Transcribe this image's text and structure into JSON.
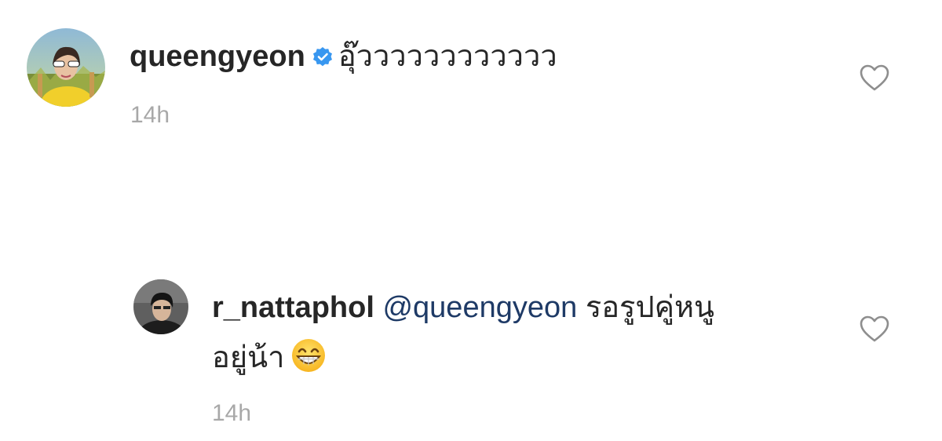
{
  "comments": [
    {
      "username": "queengyeon",
      "verified": true,
      "text": "อุ๊วววววววววววว",
      "time": "14h",
      "like_icon": "heart-outline-icon"
    },
    {
      "username": "r_nattaphol",
      "mention": "@queengyeon",
      "text_line1": "รอรูปคู่หนู",
      "text_line2": "อยู่น้า",
      "emoji_icon": "grinning-face-emoji-icon",
      "time": "14h",
      "like_icon": "heart-outline-icon"
    }
  ],
  "colors": {
    "text": "#262626",
    "mention": "#1e3a66",
    "timestamp": "#a8a8a8",
    "verified_badge": "#3897f0"
  }
}
